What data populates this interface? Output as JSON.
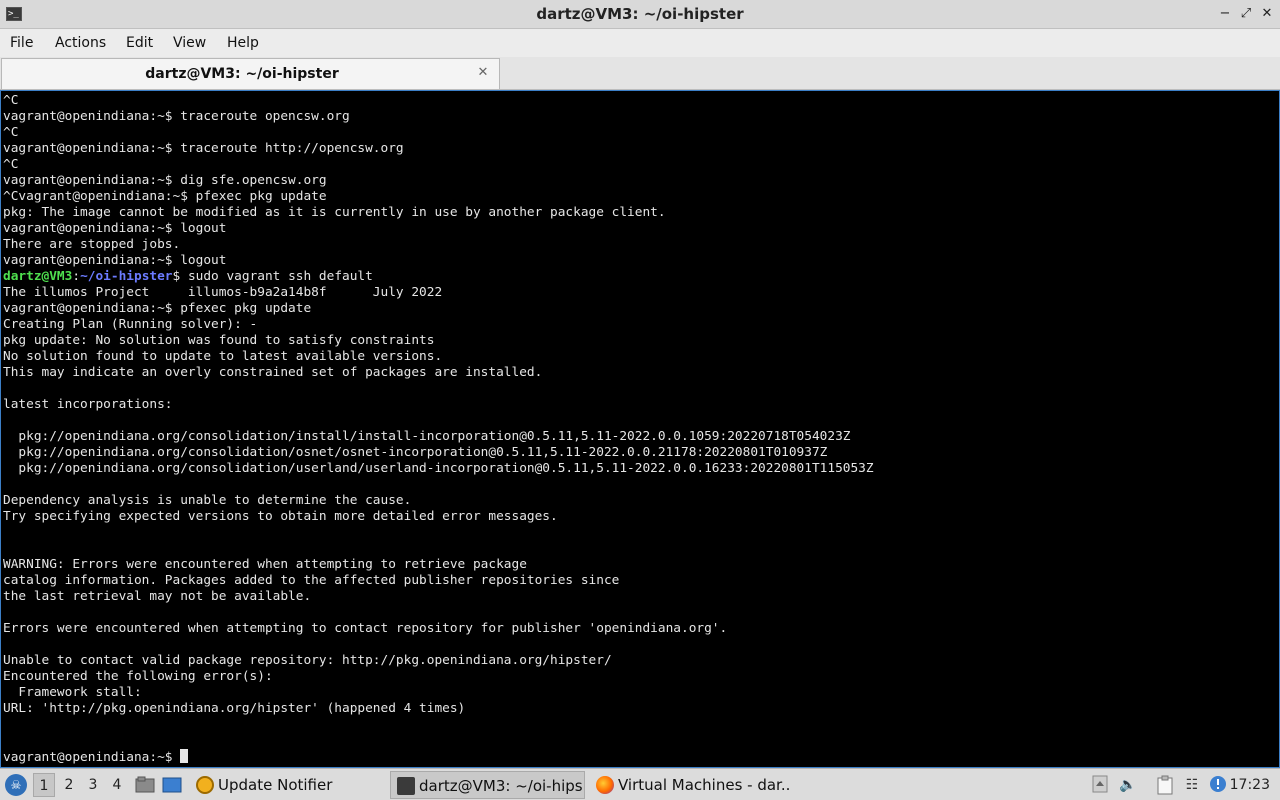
{
  "window": {
    "title": "dartz@VM3: ~/oi-hipster",
    "app_icon_glyph": ">_",
    "controls": {
      "minimize": "−",
      "maximize": "⤢",
      "close": "✕"
    }
  },
  "menu": {
    "file": "File",
    "actions": "Actions",
    "edit": "Edit",
    "view": "View",
    "help": "Help"
  },
  "tab": {
    "title": "dartz@VM3: ~/oi-hipster",
    "close_glyph": "✕"
  },
  "terminal": {
    "lines": [
      "^C",
      "vagrant@openindiana:~$ traceroute opencsw.org",
      "^C",
      "vagrant@openindiana:~$ traceroute http://opencsw.org",
      "^C",
      "vagrant@openindiana:~$ dig sfe.opencsw.org",
      "^Cvagrant@openindiana:~$ pfexec pkg update",
      "pkg: The image cannot be modified as it is currently in use by another package client.",
      "vagrant@openindiana:~$ logout",
      "There are stopped jobs.",
      "vagrant@openindiana:~$ logout",
      "",
      "The illumos Project     illumos-b9a2a14b8f      July 2022",
      "vagrant@openindiana:~$ pfexec pkg update",
      "Creating Plan (Running solver): -",
      "pkg update: No solution was found to satisfy constraints",
      "No solution found to update to latest available versions.",
      "This may indicate an overly constrained set of packages are installed.",
      "",
      "latest incorporations:",
      "",
      "  pkg://openindiana.org/consolidation/install/install-incorporation@0.5.11,5.11-2022.0.0.1059:20220718T054023Z",
      "  pkg://openindiana.org/consolidation/osnet/osnet-incorporation@0.5.11,5.11-2022.0.0.21178:20220801T010937Z",
      "  pkg://openindiana.org/consolidation/userland/userland-incorporation@0.5.11,5.11-2022.0.0.16233:20220801T115053Z",
      "",
      "Dependency analysis is unable to determine the cause.",
      "Try specifying expected versions to obtain more detailed error messages.",
      "",
      "",
      "WARNING: Errors were encountered when attempting to retrieve package",
      "catalog information. Packages added to the affected publisher repositories since",
      "the last retrieval may not be available.",
      "",
      "Errors were encountered when attempting to contact repository for publisher 'openindiana.org'.",
      "",
      "Unable to contact valid package repository: http://pkg.openindiana.org/hipster/",
      "Encountered the following error(s):",
      "  Framework stall:",
      "URL: 'http://pkg.openindiana.org/hipster' (happened 4 times)",
      "",
      "",
      "vagrant@openindiana:~$ "
    ],
    "host_prompt": {
      "user": "dartz@VM3",
      "colon": ":",
      "path": "~/oi-hipster",
      "dollar": "$",
      "command": " sudo vagrant ssh default"
    },
    "colors": {
      "background": "#000000",
      "text": "#e6e6e6",
      "prompt_user": "#4fe04f",
      "prompt_path": "#6b7bff"
    }
  },
  "taskbar": {
    "start_glyph": "☠",
    "workspaces": [
      "1",
      "2",
      "3",
      "4"
    ],
    "active_workspace": "1",
    "tasks": [
      {
        "label": "Update Notifier",
        "icon": "update-notifier-icon"
      },
      {
        "label": "dartz@VM3: ~/oi-hips...",
        "icon": "terminal-icon"
      },
      {
        "label": "Virtual Machines - dar...",
        "icon": "firefox-icon"
      }
    ],
    "tray": {
      "volume_glyph": "🔈",
      "network_glyph": "☷"
    },
    "clock": "17:23"
  }
}
